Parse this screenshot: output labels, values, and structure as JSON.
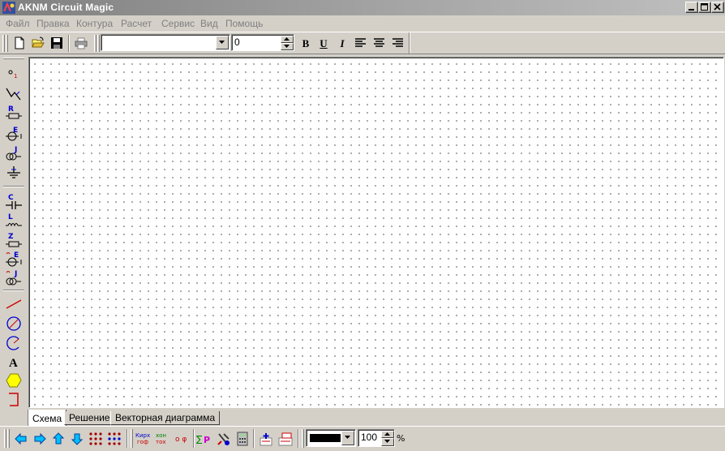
{
  "window": {
    "title": "AKNM  Circuit Magic"
  },
  "menu": {
    "items": [
      {
        "label": "Файл"
      },
      {
        "label": "Правка"
      },
      {
        "label": "Контура"
      },
      {
        "label": "Расчет"
      },
      {
        "label": "Сервис"
      },
      {
        "label": "Вид"
      },
      {
        "label": "Помощь"
      }
    ]
  },
  "toolbar": {
    "font_combo_value": "",
    "size_value": "0",
    "bold_label": "B",
    "underline_label": "U",
    "italic_label": "I"
  },
  "left_tools": {
    "node_label": "o",
    "node_sub": "1",
    "r_label": "R",
    "e_label": "E",
    "j_label": "J",
    "c_label": "C",
    "l_label": "L",
    "z_label": "Z",
    "text_tool_label": "A"
  },
  "tabs": [
    {
      "label": "Схема"
    },
    {
      "label": "Решение"
    },
    {
      "label": "Векторная диаграмма"
    }
  ],
  "bottom_toolbar": {
    "kirh_top": "Кирх",
    "kirh_bottom": "гоф",
    "xoh_top": "хон",
    "xoh_bottom": "тох",
    "phi_label": "o φ",
    "power_label": "P",
    "zoom_value": "100",
    "zoom_unit": "%"
  },
  "colors": {
    "line_color": "#000000",
    "accent_blue": "#0000cc",
    "accent_red": "#cc0000"
  }
}
